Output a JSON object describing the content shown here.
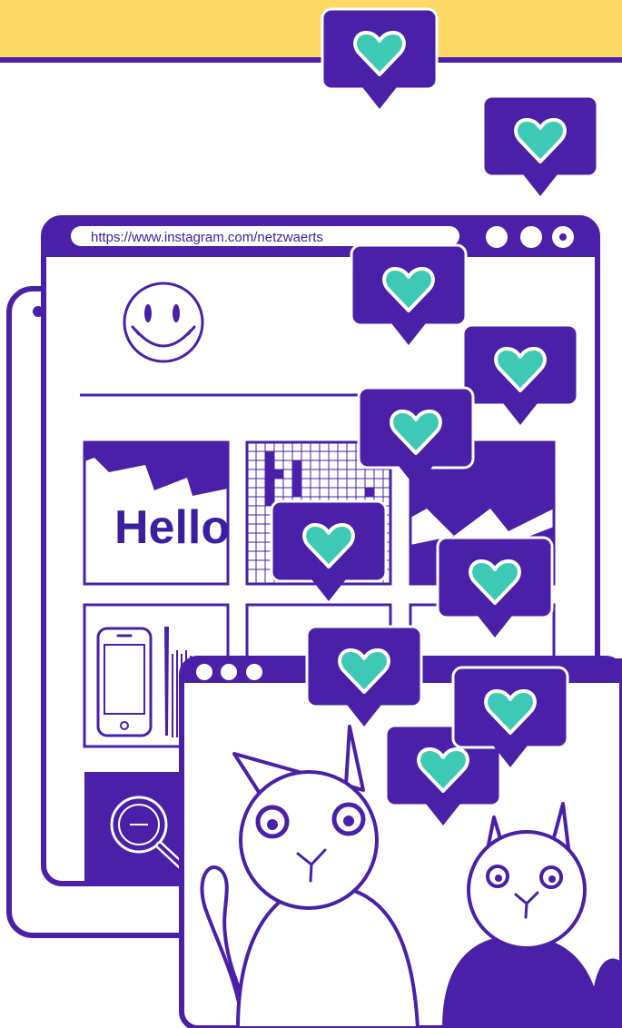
{
  "browser_main": {
    "address_url": "https://www.instagram.com/netzwaerts"
  },
  "feed": {
    "tile_1_text": "Hello"
  },
  "colors": {
    "banner": "#fdd865",
    "accent": "#4a20a8",
    "heart": "#3ec8b6",
    "ink": "#3b1fa0"
  },
  "icons": {
    "like_bubble": "heart-icon",
    "avatar": "smiley-icon",
    "search": "magnifier-icon"
  }
}
